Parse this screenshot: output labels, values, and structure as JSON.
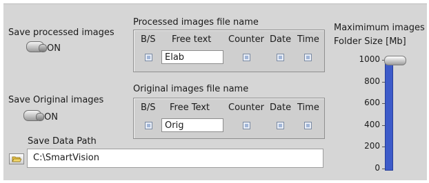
{
  "save_processed": {
    "label": "Save processed images",
    "state": "ON"
  },
  "save_original": {
    "label": "Save Original images",
    "state": "ON"
  },
  "processed_name": {
    "title": "Processed images file name",
    "headers": {
      "bs": "B/S",
      "free": "Free text",
      "counter": "Counter",
      "date": "Date",
      "time": "Time"
    },
    "free_text_value": "Elab"
  },
  "original_name": {
    "title": "Original images file name",
    "headers": {
      "bs": "B/S",
      "free": "Free Text",
      "counter": "Counter",
      "date": "Date",
      "time": "Time"
    },
    "free_text_value": "Orig"
  },
  "save_path": {
    "label": "Save Data Path",
    "value": "C:\\SmartVision"
  },
  "folder_size": {
    "label_line1": "Maximimum images",
    "label_line2": "Folder Size [Mb]",
    "ticks": [
      "1000",
      "800",
      "600",
      "400",
      "200",
      "0"
    ],
    "value_mb": 1000,
    "track_color": "#3d5bc9"
  }
}
